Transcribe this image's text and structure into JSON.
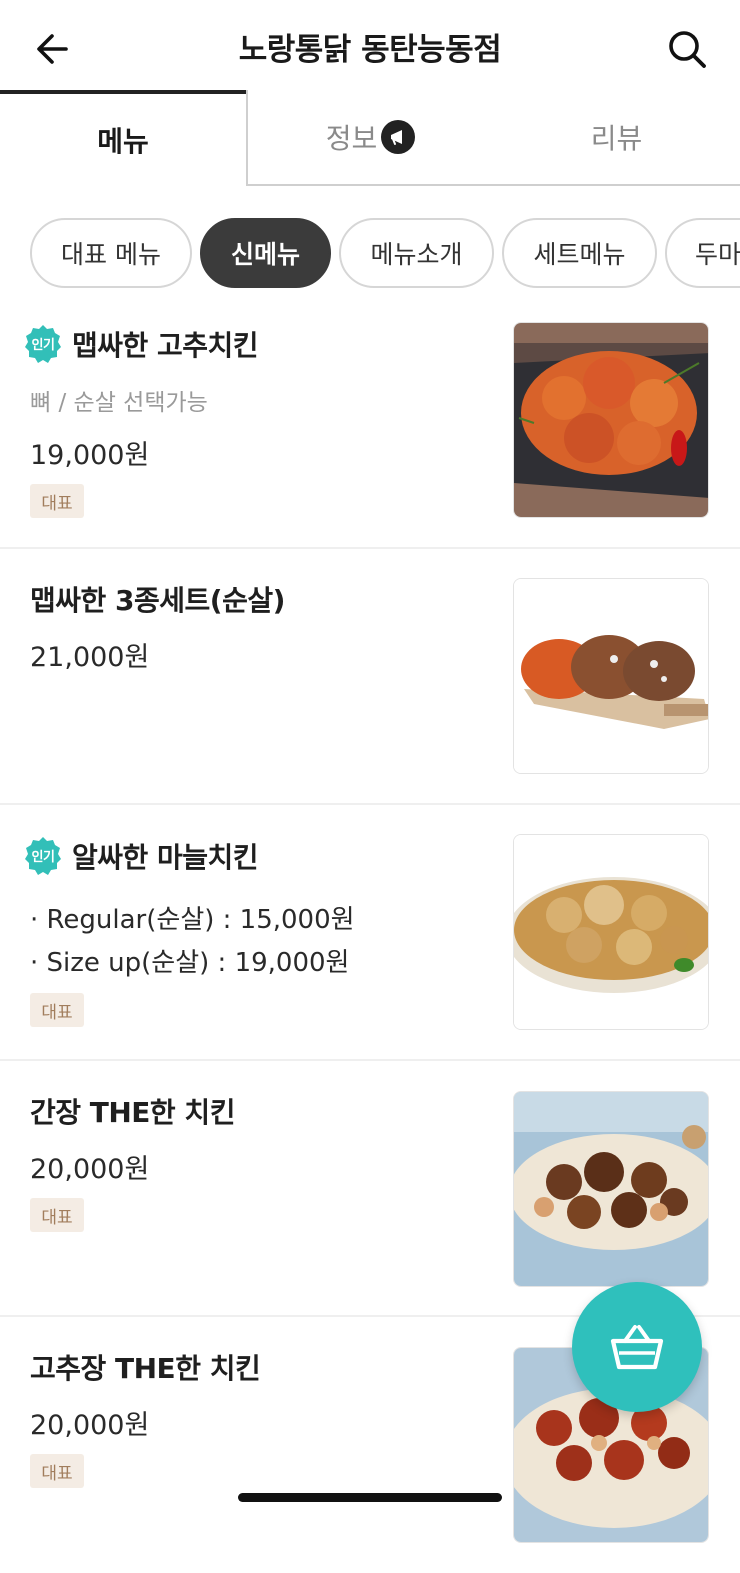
{
  "header": {
    "title": "노랑통닭 동탄능동점",
    "back_icon": "arrow-left-icon",
    "search_icon": "search-icon"
  },
  "tabs": [
    {
      "label": "메뉴",
      "active": true
    },
    {
      "label": "정보",
      "active": false,
      "badge_icon": "megaphone-icon"
    },
    {
      "label": "리뷰",
      "active": false
    }
  ],
  "chips": [
    {
      "label": "대표 메뉴",
      "active": false
    },
    {
      "label": "신메뉴",
      "active": true
    },
    {
      "label": "메뉴소개",
      "active": false
    },
    {
      "label": "세트메뉴",
      "active": false
    },
    {
      "label": "두마",
      "active": false
    }
  ],
  "popular_badge_label": "인기",
  "menu_items": [
    {
      "name": "맵싸한 고추치킨",
      "popular": true,
      "description": "뼈 / 순살 선택가능",
      "price": "19,000원",
      "tag": "대표"
    },
    {
      "name": "맵싸한 3종세트(순살)",
      "popular": false,
      "price": "21,000원"
    },
    {
      "name": "알싸한 마늘치킨",
      "popular": true,
      "lines": [
        "· Regular(순살) : 15,000원",
        "· Size up(순살) : 19,000원"
      ],
      "tag": "대표"
    },
    {
      "name": "간장 THE한 치킨",
      "popular": false,
      "price": "20,000원",
      "tag": "대표"
    },
    {
      "name": "고추장 THE한 치킨",
      "popular": false,
      "price": "20,000원",
      "tag": "대표"
    }
  ],
  "cart_icon": "basket-icon",
  "colors": {
    "accent": "#2fc0bc",
    "tag_bg": "#f4ece4",
    "tag_text": "#a17d5c",
    "chip_active": "#3b3b3b"
  }
}
